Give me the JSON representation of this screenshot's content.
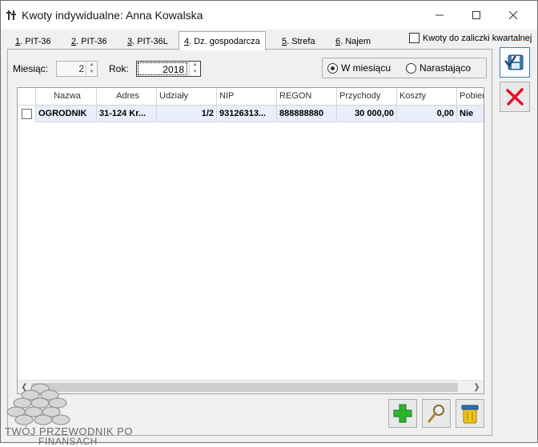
{
  "window": {
    "title": "Kwoty indywidualne: Anna Kowalska"
  },
  "tabs": [
    {
      "key": "1",
      "label": ". PIT-36"
    },
    {
      "key": "2",
      "label": ". PIT-36"
    },
    {
      "key": "3",
      "label": ". PIT-36L"
    },
    {
      "key": "4",
      "label": ". Dz. gospodarcza"
    },
    {
      "key": "5",
      "label": ". Strefa"
    },
    {
      "key": "6",
      "label": ". Najem"
    }
  ],
  "active_tab": 3,
  "quarterly_checkbox": {
    "label": "Kwoty do zaliczki kwartalnej",
    "checked": false
  },
  "filters": {
    "month_label": "Miesiąc:",
    "month_value": "2",
    "year_label": "Rok:",
    "year_value": "2018"
  },
  "period_mode": {
    "options": [
      "W miesiącu",
      "Narastająco"
    ],
    "selected": "W miesiącu"
  },
  "grid": {
    "columns": [
      "Nazwa",
      "Adres",
      "Udziały",
      "NIP",
      "REGON",
      "Przychody",
      "Koszty",
      "Pobiera"
    ],
    "rows": [
      {
        "checked": false,
        "nazwa": "OGRODNIK",
        "adres": "31-124 Kr...",
        "udzialy": "1/2",
        "nip": "93126313...",
        "regon": "888888880",
        "przychody": "30 000,00",
        "koszty": "0,00",
        "pobiera": "Nie"
      }
    ]
  },
  "logo": {
    "line1": "TWÓJ PRZEWODNIK PO",
    "line2": "FINANSACH"
  },
  "colors": {
    "accent": "#3c7fb1",
    "row_highlight": "#e8eefb",
    "cancel_red": "#e81123",
    "add_green": "#2bb52b"
  }
}
